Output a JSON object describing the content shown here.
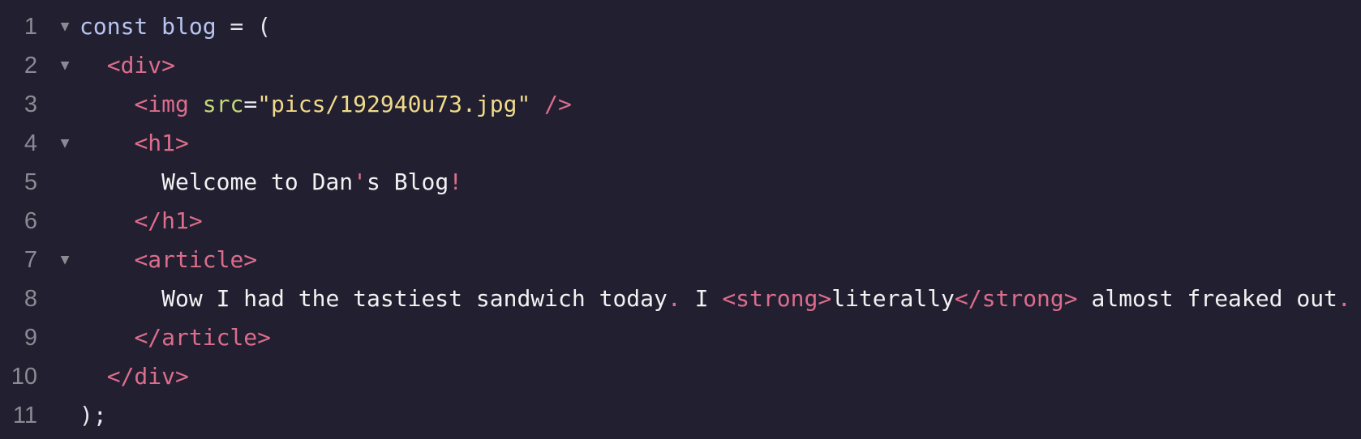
{
  "editor": {
    "lines": [
      {
        "number": "1",
        "folded": true,
        "indent": "",
        "tokens": [
          {
            "t": "const blog",
            "c": "tk-kw"
          },
          {
            "t": " = (",
            "c": "tk-plain"
          }
        ]
      },
      {
        "number": "2",
        "folded": true,
        "indent": "  ",
        "tokens": [
          {
            "t": "<div>",
            "c": "tk-tag"
          }
        ]
      },
      {
        "number": "3",
        "folded": false,
        "indent": "    ",
        "tokens": [
          {
            "t": "<img ",
            "c": "tk-tag"
          },
          {
            "t": "src",
            "c": "tk-attr"
          },
          {
            "t": "=",
            "c": "tk-plain"
          },
          {
            "t": "\"pics/192940u73.jpg\"",
            "c": "tk-str"
          },
          {
            "t": " />",
            "c": "tk-tag"
          }
        ]
      },
      {
        "number": "4",
        "folded": true,
        "indent": "    ",
        "tokens": [
          {
            "t": "<h1>",
            "c": "tk-tag"
          }
        ]
      },
      {
        "number": "5",
        "folded": false,
        "indent": "      ",
        "tokens": [
          {
            "t": "Welcome to Dan",
            "c": "tk-text"
          },
          {
            "t": "'",
            "c": "tk-punct"
          },
          {
            "t": "s Blog",
            "c": "tk-text"
          },
          {
            "t": "!",
            "c": "tk-punct"
          }
        ]
      },
      {
        "number": "6",
        "folded": false,
        "indent": "    ",
        "tokens": [
          {
            "t": "</h1>",
            "c": "tk-tag"
          }
        ]
      },
      {
        "number": "7",
        "folded": true,
        "indent": "    ",
        "tokens": [
          {
            "t": "<article>",
            "c": "tk-tag"
          }
        ]
      },
      {
        "number": "8",
        "folded": false,
        "indent": "      ",
        "tokens": [
          {
            "t": "Wow I had the tastiest sandwich today",
            "c": "tk-text"
          },
          {
            "t": ".",
            "c": "tk-punct"
          },
          {
            "t": " I ",
            "c": "tk-text"
          },
          {
            "t": "<strong>",
            "c": "tk-tag"
          },
          {
            "t": "literally",
            "c": "tk-text"
          },
          {
            "t": "</strong>",
            "c": "tk-tag"
          },
          {
            "t": " almost freaked out",
            "c": "tk-text"
          },
          {
            "t": ".",
            "c": "tk-punct"
          }
        ]
      },
      {
        "number": "9",
        "folded": false,
        "indent": "    ",
        "tokens": [
          {
            "t": "</article>",
            "c": "tk-tag"
          }
        ]
      },
      {
        "number": "10",
        "folded": false,
        "indent": "  ",
        "tokens": [
          {
            "t": "</div>",
            "c": "tk-tag"
          }
        ]
      },
      {
        "number": "11",
        "folded": false,
        "indent": "",
        "tokens": [
          {
            "t": ");",
            "c": "tk-plain"
          }
        ]
      }
    ],
    "fold_icon": "fold-triangle-down-icon",
    "colors": {
      "background": "#221f30",
      "gutter": "#8b8a94",
      "keyword": "#b8c5f0",
      "tag": "#dc6d8c",
      "attribute": "#c5d97a",
      "string": "#f0db8a",
      "text": "#f2f2f2"
    }
  }
}
